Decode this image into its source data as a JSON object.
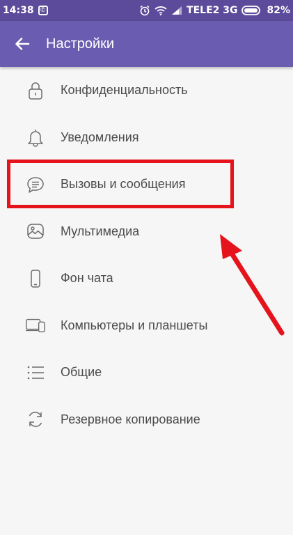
{
  "status_bar": {
    "time": "14:38",
    "carrier": "TELE2 3G",
    "battery_percent": "82%",
    "icons": [
      "viber-notification-icon",
      "alarm-icon",
      "wifi-icon",
      "signal-icon",
      "battery-icon"
    ]
  },
  "app_bar": {
    "title": "Настройки",
    "back_icon": "arrow-left-icon"
  },
  "settings": {
    "items": [
      {
        "label": "Конфиденциальность",
        "icon": "lock-icon"
      },
      {
        "label": "Уведомления",
        "icon": "bell-icon"
      },
      {
        "label": "Вызовы и сообщения",
        "icon": "message-icon"
      },
      {
        "label": "Мультимедиа",
        "icon": "image-icon"
      },
      {
        "label": "Фон чата",
        "icon": "phone-icon"
      },
      {
        "label": "Компьютеры и планшеты",
        "icon": "devices-icon"
      },
      {
        "label": "Общие",
        "icon": "list-icon"
      },
      {
        "label": "Резервное копирование",
        "icon": "sync-icon"
      }
    ]
  },
  "annotation": {
    "highlighted_item": "Вызовы и сообщения",
    "color": "#e5131b"
  },
  "colors": {
    "status_bar": "#5b4b9a",
    "app_bar": "#6a5cb0",
    "background": "#f6f6f6",
    "label_text": "#4b4b4b",
    "icon_stroke": "#6b6b6b"
  }
}
